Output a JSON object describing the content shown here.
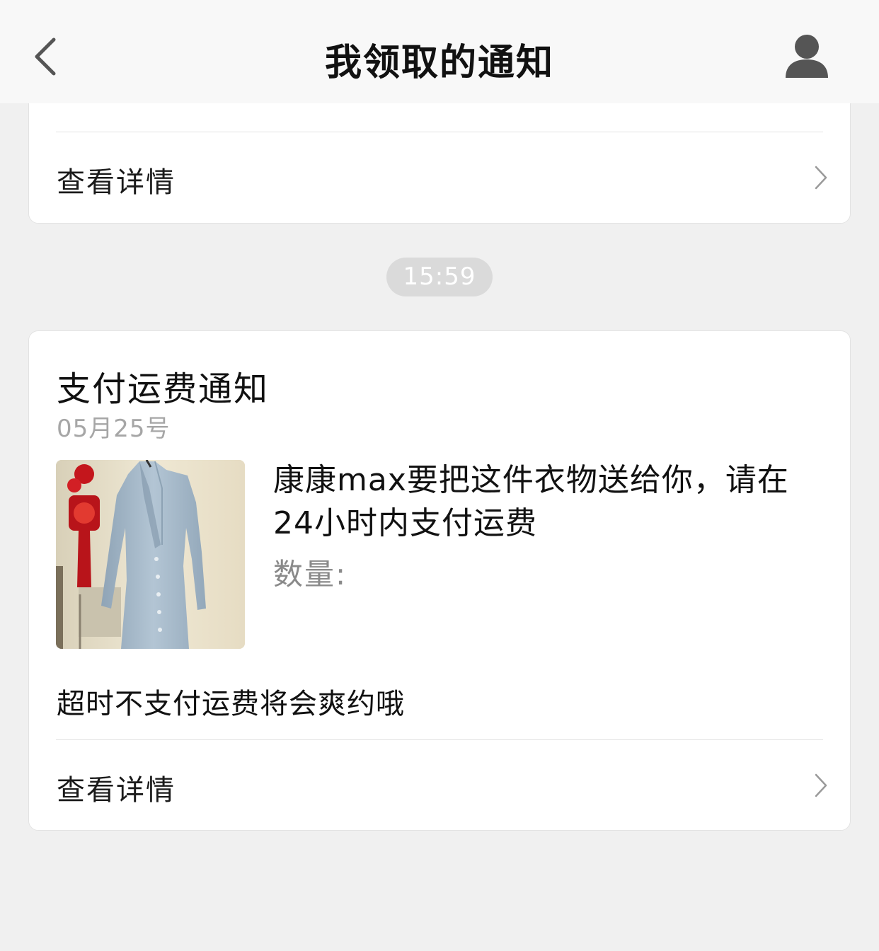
{
  "header": {
    "title": "我领取的通知",
    "back_icon": "chevron-left-icon",
    "profile_icon": "user-icon"
  },
  "previous_card": {
    "detail_label": "查看详情"
  },
  "timestamp": "15:59",
  "notification": {
    "title": "支付运费通知",
    "date": "05月25号",
    "image_alt": "light blue dress",
    "message": "康康max要把这件衣物送给你，请在24小时内支付运费",
    "quantity_label": "数量:",
    "timeout_note": "超时不支付运费将会爽约哦",
    "detail_label": "查看详情"
  },
  "colors": {
    "page_bg": "#f0f0f0",
    "card_bg": "#ffffff",
    "muted_text": "#a6a6a6",
    "pill_bg": "#dadada"
  }
}
